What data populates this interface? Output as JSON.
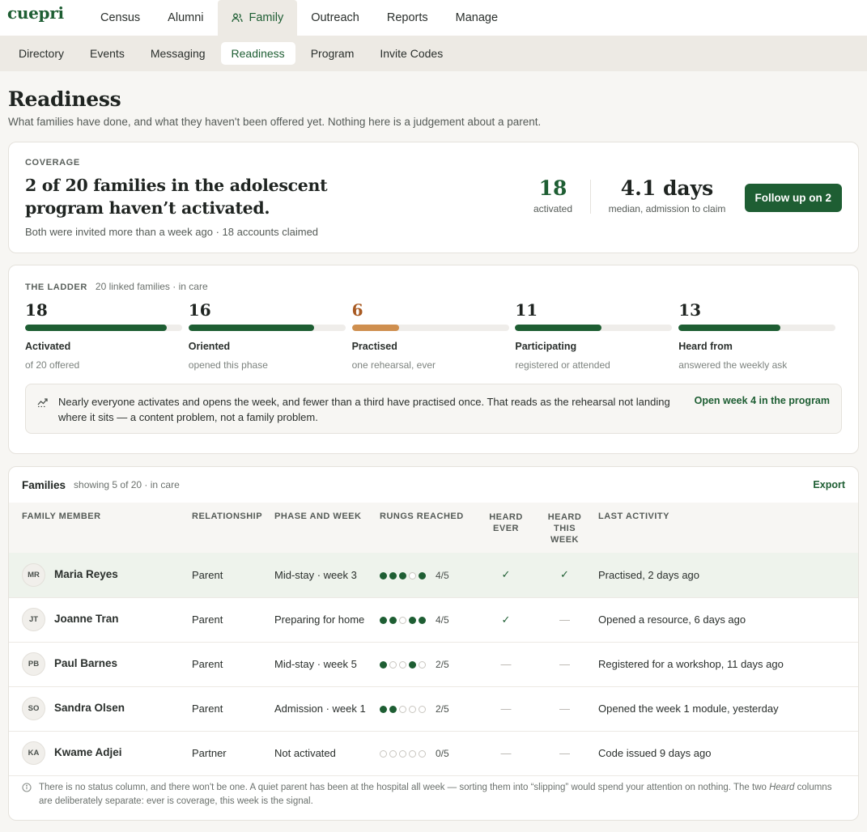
{
  "app": {
    "logo": "cuepri"
  },
  "topnav": [
    {
      "label": "Census",
      "active": false
    },
    {
      "label": "Alumni",
      "active": false
    },
    {
      "label": "Family",
      "active": true
    },
    {
      "label": "Outreach",
      "active": false
    },
    {
      "label": "Reports",
      "active": false
    },
    {
      "label": "Manage",
      "active": false
    }
  ],
  "subnav": [
    {
      "label": "Directory",
      "active": false
    },
    {
      "label": "Events",
      "active": false
    },
    {
      "label": "Messaging",
      "active": false
    },
    {
      "label": "Readiness",
      "active": true
    },
    {
      "label": "Program",
      "active": false
    },
    {
      "label": "Invite Codes",
      "active": false
    }
  ],
  "page": {
    "title": "Readiness",
    "subtitle": "What families have done, and what they haven't been offered yet. Nothing here is a judgement about a parent."
  },
  "coverage": {
    "eyebrow": "COVERAGE",
    "headline": "2 of 20 families in the adolescent program haven’t activated.",
    "note": "Both were invited more than a week ago · 18 accounts claimed",
    "activated_value": "18",
    "activated_label": "activated",
    "median_value": "4.1 days",
    "median_label": "median, admission to claim",
    "button": "Follow up on 2"
  },
  "ladder": {
    "eyebrow": "THE LADDER",
    "sub": "20 linked families · in care",
    "total": 20,
    "rungs": [
      {
        "value": "18",
        "label": "Activated",
        "sub": "of 20 offered",
        "fraction": 0.9,
        "warn": false
      },
      {
        "value": "16",
        "label": "Oriented",
        "sub": "opened this phase",
        "fraction": 0.8,
        "warn": false
      },
      {
        "value": "6",
        "label": "Practised",
        "sub": "one rehearsal, ever",
        "fraction": 0.3,
        "warn": true
      },
      {
        "value": "11",
        "label": "Participating",
        "sub": "registered or attended",
        "fraction": 0.55,
        "warn": false
      },
      {
        "value": "13",
        "label": "Heard from",
        "sub": "answered the weekly ask",
        "fraction": 0.65,
        "warn": false
      }
    ],
    "insight": "Nearly everyone activates and opens the week, and fewer than a third have practised once. That reads as the rehearsal not landing where it sits — a content problem, not a family problem.",
    "insight_link": "Open week 4 in the program"
  },
  "families": {
    "title": "Families",
    "sub": "showing 5 of 20 · in care",
    "export": "Export",
    "columns": {
      "member": "FAMILY MEMBER",
      "relationship": "RELATIONSHIP",
      "phase": "PHASE AND WEEK",
      "rungs": "RUNGS REACHED",
      "heard_ever": "HEARD EVER",
      "heard_week": "HEARD THIS WEEK",
      "last": "LAST ACTIVITY"
    },
    "rows": [
      {
        "initials": "MR",
        "name": "Maria Reyes",
        "relationship": "Parent",
        "phase": "Mid-stay · week 3",
        "rungs": [
          1,
          1,
          1,
          0,
          1
        ],
        "rungs_text": "4/5",
        "heard_ever": "✓",
        "heard_week": "✓",
        "last": "Practised, 2 days ago",
        "selected": true
      },
      {
        "initials": "JT",
        "name": "Joanne Tran",
        "relationship": "Parent",
        "phase": "Preparing for home",
        "rungs": [
          1,
          1,
          0,
          1,
          1
        ],
        "rungs_text": "4/5",
        "heard_ever": "✓",
        "heard_week": "—",
        "last": "Opened a resource, 6 days ago",
        "selected": false
      },
      {
        "initials": "PB",
        "name": "Paul Barnes",
        "relationship": "Parent",
        "phase": "Mid-stay · week 5",
        "rungs": [
          1,
          0,
          0,
          1,
          0
        ],
        "rungs_text": "2/5",
        "heard_ever": "—",
        "heard_week": "—",
        "last": "Registered for a workshop, 11 days ago",
        "selected": false
      },
      {
        "initials": "SO",
        "name": "Sandra Olsen",
        "relationship": "Parent",
        "phase": "Admission · week 1",
        "rungs": [
          1,
          1,
          0,
          0,
          0
        ],
        "rungs_text": "2/5",
        "heard_ever": "—",
        "heard_week": "—",
        "last": "Opened the week 1 module, yesterday",
        "selected": false
      },
      {
        "initials": "KA",
        "name": "Kwame Adjei",
        "relationship": "Partner",
        "phase": "Not activated",
        "rungs": [
          0,
          0,
          0,
          0,
          0
        ],
        "rungs_text": "0/5",
        "heard_ever": "—",
        "heard_week": "—",
        "last": "Code issued 9 days ago",
        "selected": false
      }
    ],
    "footnote_a": "There is no status column, and there won't be one. A quiet parent has been at the hospital all week — sorting them into “slipping” would spend your attention on nothing. The two ",
    "footnote_em": "Heard",
    "footnote_b": " columns are deliberately separate: ever is coverage, this week is the signal."
  },
  "colors": {
    "brand": "#1e5e33",
    "warn": "#cf8f4f",
    "selected_row": "#eef3ec"
  }
}
